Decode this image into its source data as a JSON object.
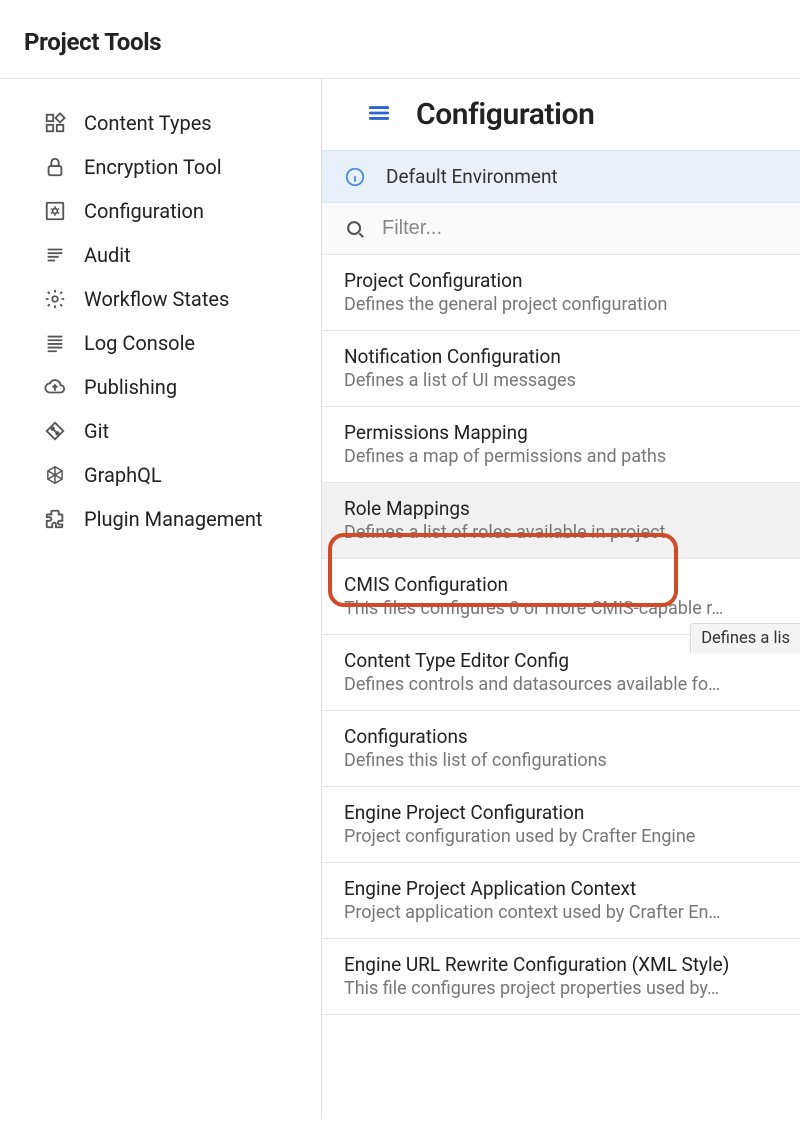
{
  "pageTitle": "Project Tools",
  "sidebar": {
    "items": [
      {
        "label": "Content Types"
      },
      {
        "label": "Encryption Tool"
      },
      {
        "label": "Configuration"
      },
      {
        "label": "Audit"
      },
      {
        "label": "Workflow States"
      },
      {
        "label": "Log Console"
      },
      {
        "label": "Publishing"
      },
      {
        "label": "Git"
      },
      {
        "label": "GraphQL"
      },
      {
        "label": "Plugin Management"
      }
    ]
  },
  "main": {
    "title": "Configuration",
    "environmentBanner": "Default Environment",
    "filterPlaceholder": "Filter...",
    "items": [
      {
        "title": "Project Configuration",
        "desc": "Defines the general project configuration"
      },
      {
        "title": "Notification Configuration",
        "desc": "Defines a list of UI messages"
      },
      {
        "title": "Permissions Mapping",
        "desc": "Defines a map of permissions and paths"
      },
      {
        "title": "Role Mappings",
        "desc": "Defines a list of roles available in project"
      },
      {
        "title": "CMIS Configuration",
        "desc": "This files configures 0 or more CMIS-capable r…"
      },
      {
        "title": "Content Type Editor Config",
        "desc": "Defines controls and datasources available fo…"
      },
      {
        "title": "Configurations",
        "desc": "Defines this list of configurations"
      },
      {
        "title": "Engine Project Configuration",
        "desc": "Project configuration used by Crafter Engine"
      },
      {
        "title": "Engine Project Application Context",
        "desc": "Project application context used by Crafter En…"
      },
      {
        "title": "Engine URL Rewrite Configuration (XML Style)",
        "desc": "This file configures project properties used by…"
      }
    ],
    "selectedIndex": 3,
    "tooltipText": "Defines a lis"
  }
}
